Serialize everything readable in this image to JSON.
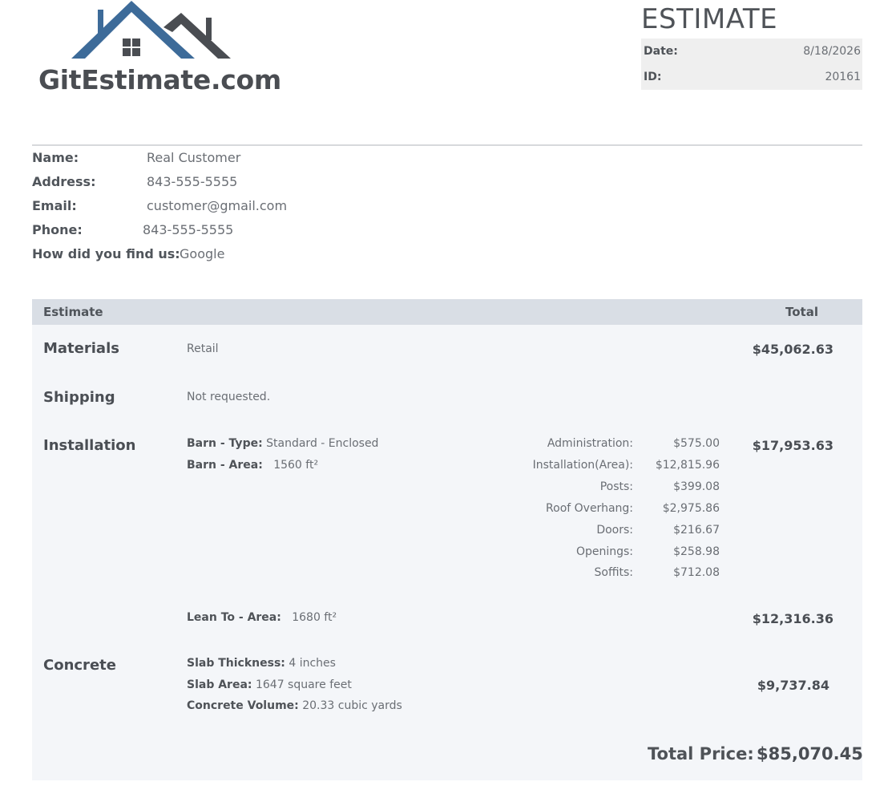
{
  "header": {
    "logo_text": "GitEstimate.com",
    "title": "ESTIMATE",
    "date_label": "Date:",
    "date_value": "8/18/2026",
    "id_label": "ID:",
    "id_value": "20161"
  },
  "customer": {
    "name_label": "Name:",
    "name_value": "Real Customer",
    "address_label": "Address:",
    "address_value": "843-555-5555",
    "email_label": "Email:",
    "email_value": "customer@gmail.com",
    "phone_label": "Phone:",
    "phone_value": "843-555-5555",
    "source_label": "How did you find us:",
    "source_value": "Google"
  },
  "estimate": {
    "col_estimate": "Estimate",
    "col_total": "Total",
    "materials": {
      "title": "Materials",
      "desc": "Retail",
      "amount": "$45,062.63"
    },
    "shipping": {
      "title": "Shipping",
      "desc": "Not requested."
    },
    "installation": {
      "title": "Installation",
      "barn_type_label": "Barn - Type:",
      "barn_type_value": "Standard - Enclosed",
      "barn_area_label": "Barn - Area:",
      "barn_area_value": "1560 ft²",
      "amount": "$17,953.63",
      "breakdown": [
        {
          "label": "Administration:",
          "value": "$575.00"
        },
        {
          "label": "Installation(Area):",
          "value": "$12,815.96"
        },
        {
          "label": "Posts:",
          "value": "$399.08"
        },
        {
          "label": "Roof Overhang:",
          "value": "$2,975.86"
        },
        {
          "label": "Doors:",
          "value": "$216.67"
        },
        {
          "label": "Openings:",
          "value": "$258.98"
        },
        {
          "label": "Soffits:",
          "value": "$712.08"
        }
      ],
      "lean_to_label": "Lean To - Area:",
      "lean_to_value": "1680 ft²",
      "lean_to_amount": "$12,316.36"
    },
    "concrete": {
      "title": "Concrete",
      "thickness_label": "Slab Thickness:",
      "thickness_value": "4 inches",
      "area_label": "Slab Area:",
      "area_value": "1647 square feet",
      "volume_label": "Concrete Volume:",
      "volume_value": "20.33 cubic yards",
      "amount": "$9,737.84"
    },
    "total_label": "Total Price:",
    "total_value": "$85,070.45"
  },
  "colors": {
    "logo_blue": "#3d6b99",
    "logo_gray": "#4a4d52",
    "header_band": "#d9dee5",
    "panel_bg": "#f4f6f9",
    "meta_bg": "#efefef"
  }
}
